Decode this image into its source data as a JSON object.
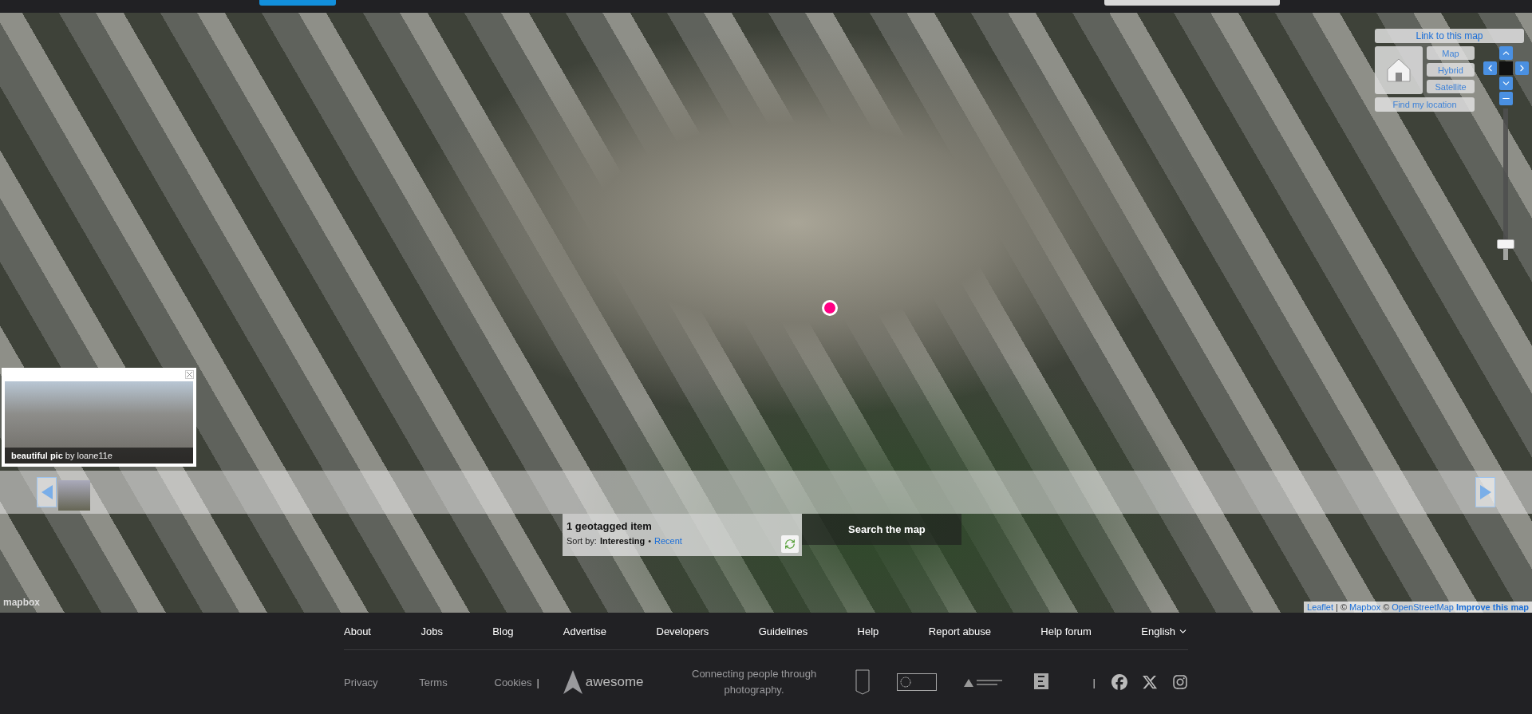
{
  "map": {
    "link": "Link to this map",
    "map_types": [
      {
        "label": "Map"
      },
      {
        "label": "Hybrid"
      },
      {
        "label": "Satellite"
      }
    ],
    "find_location": "Find my location",
    "zoom": {
      "level": 0.92
    },
    "popup": {
      "caption": "**beautiful pic** by loane11e"
    },
    "results": {
      "count": "1 geotagged item",
      "sort_label": "Sort by:",
      "separator": "•",
      "sort_options": [
        {
          "label": "Interesting",
          "selected": true
        },
        {
          "label": "Recent",
          "selected": false
        }
      ]
    },
    "search": "Search the map",
    "logo": "mapbox",
    "attribution": [
      {
        "text": "Leaflet",
        "kind": "link"
      },
      {
        "text": "|",
        "kind": "plain"
      },
      {
        "text": "©",
        "kind": "plain"
      },
      {
        "text": "Mapbox",
        "kind": "link"
      },
      {
        "text": "©",
        "kind": "plain"
      },
      {
        "text": "OpenStreetMap",
        "kind": "link"
      },
      {
        "text": "Improve this map",
        "kind": "strong"
      }
    ]
  },
  "footer": {
    "links": [
      "About",
      "Jobs",
      "Blog",
      "Advertise",
      "Developers",
      "Guidelines",
      "Help",
      "Report abuse",
      "Help forum"
    ],
    "language": "English",
    "legal": [
      "Privacy",
      "Terms",
      "Cookies"
    ],
    "divider": "|",
    "brand": "awesome",
    "tagline": "Connecting people through photography.",
    "divider_2": "|"
  }
}
